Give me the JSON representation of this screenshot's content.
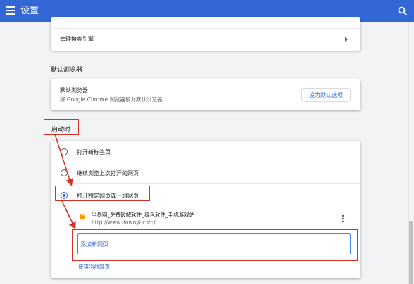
{
  "appbar": {
    "title": "设置",
    "menu_icon": "menu-icon",
    "search_icon": "search-icon",
    "color": "#3367d6"
  },
  "search_engine_card": {
    "manage_label": "管理搜索引擎"
  },
  "default_browser": {
    "section_title": "默认浏览器",
    "title": "默认浏览器",
    "description": "将 Google Chrome 浏览器设为默认浏览器",
    "button_label": "设为默认选项"
  },
  "startup": {
    "section_title": "启动时",
    "options": [
      {
        "label": "打开新标签页",
        "checked": false
      },
      {
        "label": "继续浏览上次打开的网页",
        "checked": false
      },
      {
        "label": "打开特定网页或一组网页",
        "checked": true
      }
    ],
    "pages": [
      {
        "title": "当易网_免费破解软件_绿色软件_手机游戏站",
        "url": "http://www.downyi.com/"
      }
    ],
    "add_page_placeholder": "添加新网页",
    "use_current_label": "使用当前网页"
  },
  "colors": {
    "accent": "#3367d6",
    "annotation": "#d93025"
  }
}
